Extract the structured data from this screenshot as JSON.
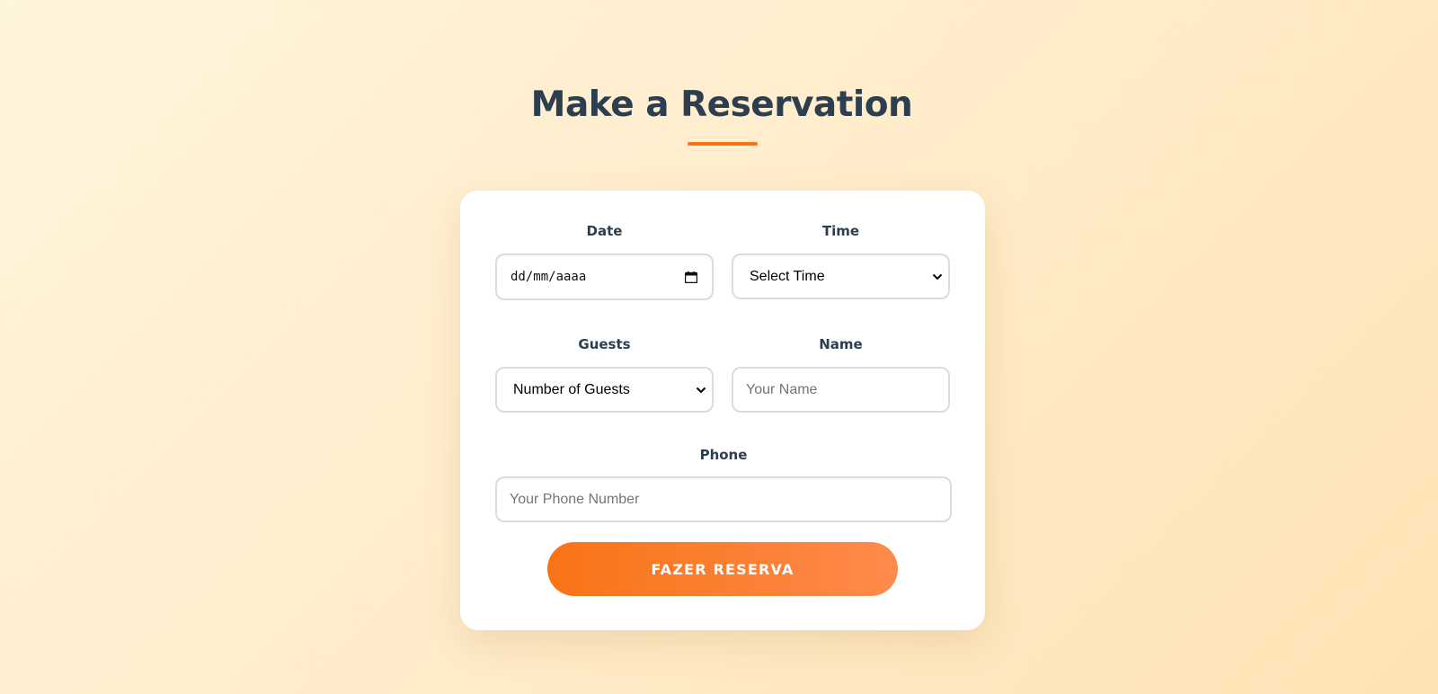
{
  "page": {
    "title": "Make a Reservation"
  },
  "colors": {
    "accent": "#f97316",
    "title_text": "#2c3e50",
    "card_background": "#ffffff"
  },
  "form": {
    "date": {
      "label": "Date",
      "value_placeholder": "dd/mm/aaaa",
      "icon": "calendar-icon"
    },
    "time": {
      "label": "Time",
      "selected": "Select Time",
      "icon": "chevron-down-icon"
    },
    "guests": {
      "label": "Guests",
      "selected": "Number of Guests",
      "icon": "chevron-down-icon"
    },
    "name": {
      "label": "Name",
      "placeholder": "Your Name",
      "value": ""
    },
    "phone": {
      "label": "Phone",
      "placeholder": "Your Phone Number",
      "value": ""
    },
    "submit_label": "FAZER RESERVA"
  }
}
